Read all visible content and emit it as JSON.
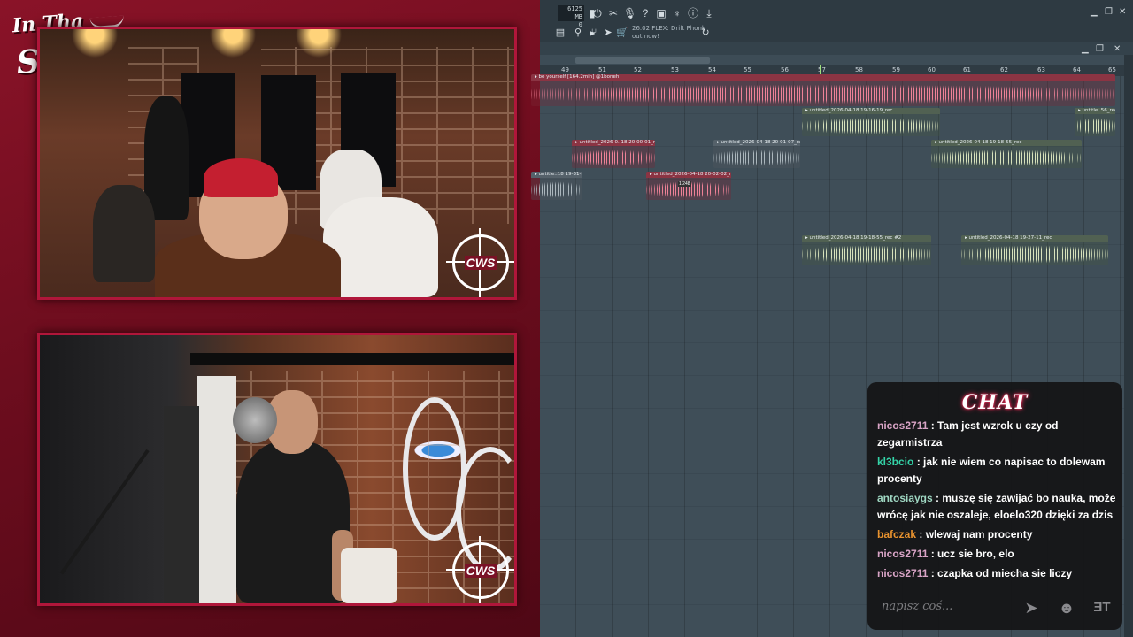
{
  "overlay": {
    "logo_line1": "In Tha",
    "logo_line2": "Studio!",
    "cam_badge": "CWS"
  },
  "daw": {
    "memory_value": "6125 MB",
    "memory_sub": "0",
    "news_line1": "26.02 FLEX: Drift Phonk",
    "news_line2": "out now!",
    "ruler": [
      "49",
      "51",
      "52",
      "53",
      "54",
      "55",
      "56",
      "57",
      "58",
      "59",
      "60",
      "61",
      "62",
      "63",
      "64",
      "65"
    ],
    "clips": [
      {
        "label": "be yourself [164.2min] @1boneh",
        "color": "pink",
        "value": ""
      },
      {
        "label": "untitled_2026-04-18 19-16-19_rec",
        "color": "green",
        "value": ""
      },
      {
        "label": "untitle..56_rec",
        "color": "green",
        "value": ""
      },
      {
        "label": "untitled_2026-0..18 20-00-01_rec",
        "color": "pink",
        "value": ""
      },
      {
        "label": "untitled_2026-04-18 20-01-07_rec",
        "color": "gray",
        "value": ""
      },
      {
        "label": "untitled_2026-04-18 19-18-55_rec",
        "color": "green",
        "value": ""
      },
      {
        "label": "untitle..18 19-31-28_rec",
        "color": "gray",
        "value": ""
      },
      {
        "label": "untitled_2026-04-18 20-02-02_rec",
        "color": "pink",
        "value": "1.248"
      },
      {
        "label": "untitled_2026-04-18 19-18-55_rec #2",
        "color": "green",
        "value": ""
      },
      {
        "label": "untitled_2026-04-18 19-27-11_rec",
        "color": "green",
        "value": ""
      }
    ]
  },
  "chat": {
    "title": "CHAT",
    "messages": [
      {
        "user": "nicos2711",
        "color": "#d9a4c6",
        "text": " : Tam jest wzrok u czy od zegarmistrza"
      },
      {
        "user": "kl3bcio",
        "color": "#34d4a8",
        "text": " : jak nie wiem co napisac to dolewam procenty"
      },
      {
        "user": "antosiaygs",
        "color": "#9fd7c2",
        "text": " : muszę się zawijać bo nauka, może wrócę jak nie oszaleje, eloelo320 dzięki za dzis"
      },
      {
        "user": "bafczak",
        "color": "#e8922e",
        "text": " : wlewaj nam procenty"
      },
      {
        "user": "nicos2711",
        "color": "#d9a4c6",
        "text": " : ucz sie bro, elo"
      },
      {
        "user": "nicos2711",
        "color": "#d9a4c6",
        "text": " : czapka od miecha sie liczy"
      }
    ],
    "input_placeholder": "napisz coś...",
    "badge": "ƎT"
  },
  "icons": [
    "send-icon",
    "emote-icon",
    "cws-badge-icon"
  ]
}
